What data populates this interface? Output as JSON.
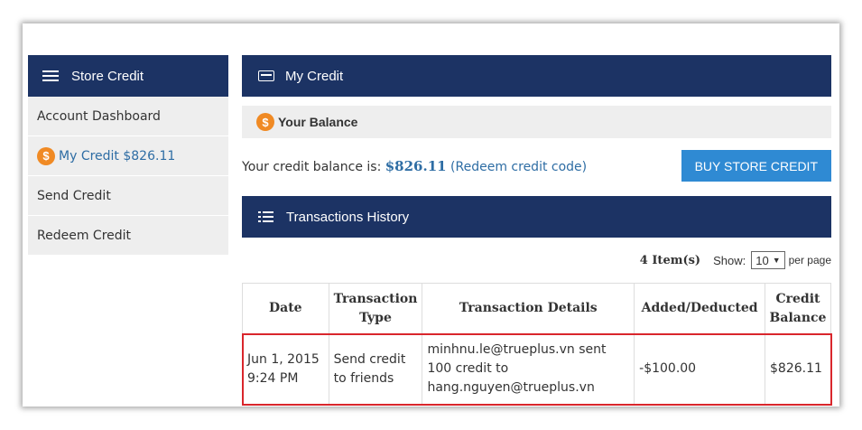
{
  "sidebar": {
    "title": "Store Credit",
    "items": [
      {
        "label": "Account Dashboard"
      },
      {
        "label": "My Credit $826.11"
      },
      {
        "label": "Send Credit"
      },
      {
        "label": "Redeem Credit"
      }
    ]
  },
  "main": {
    "header": "My Credit",
    "balance_title": "Your Balance",
    "balance_prefix": "Your credit balance is: ",
    "balance_amount": "$826.11",
    "redeem_link": "(Redeem credit code)",
    "buy_button": "BUY STORE CREDIT",
    "history_title": "Transactions History",
    "items_count": "4 Item(s)",
    "show_label": "Show:",
    "per_page_value": "10",
    "per_page_label": "per page",
    "columns": [
      "Date",
      "Transaction Type",
      "Transaction Details",
      "Added/Deducted",
      "Credit Balance"
    ],
    "rows": [
      {
        "date": "Jun 1, 2015 9:24 PM",
        "type": "Send credit to friends",
        "details": "minhnu.le@trueplus.vn sent 100 credit to hang.nguyen@trueplus.vn",
        "amount": "-$100.00",
        "balance": "$826.11"
      }
    ]
  },
  "colors": {
    "navy": "#1c3364",
    "accent_blue": "#2f8ad3",
    "link_blue": "#2e6da4",
    "coin_orange": "#f08a24",
    "highlight_red": "#d9262c"
  },
  "icons": {
    "sidebar_header": "hamburger-icon",
    "credit_header": "credit-card-icon",
    "balance": "dollar-coin-icon",
    "history_header": "list-icon"
  }
}
